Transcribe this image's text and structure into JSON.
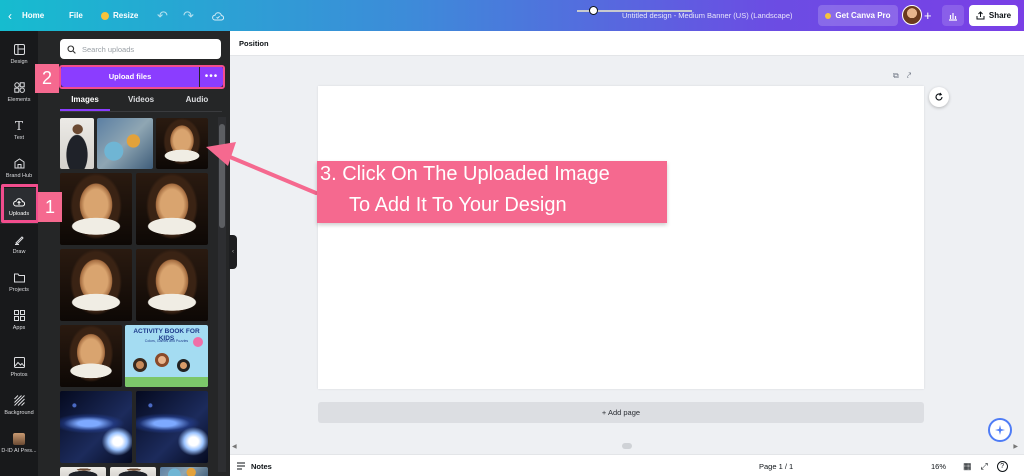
{
  "topbar": {
    "home_label": "Home",
    "file_label": "File",
    "resize_label": "Resize",
    "design_title": "Untitled design - Medium Banner (US) (Landscape)",
    "pro_label": "Get Canva Pro",
    "share_label": "Share"
  },
  "rail": {
    "items": [
      {
        "label": "Design",
        "icon": "layout-icon"
      },
      {
        "label": "Elements",
        "icon": "shapes-icon"
      },
      {
        "label": "Text",
        "icon": "text-icon"
      },
      {
        "label": "Brand Hub",
        "icon": "brand-icon"
      },
      {
        "label": "Uploads",
        "icon": "cloud-upload-icon"
      },
      {
        "label": "Draw",
        "icon": "pen-icon"
      },
      {
        "label": "Projects",
        "icon": "folder-icon"
      },
      {
        "label": "Apps",
        "icon": "apps-icon"
      },
      {
        "label": "Photos",
        "icon": "image-icon"
      },
      {
        "label": "Background",
        "icon": "pattern-icon"
      },
      {
        "label": "D-ID AI Pres...",
        "icon": "app-thumbnail"
      }
    ]
  },
  "panel": {
    "search_placeholder": "Search uploads",
    "upload_label": "Upload files",
    "more_label": "•••",
    "tabs": [
      "Images",
      "Videos",
      "Audio"
    ],
    "book_title": "ACTIVITY BOOK FOR KIDS",
    "book_subtitle": "Colors, Games and Puzzles"
  },
  "editor": {
    "position_label": "Position",
    "add_page_label": "+ Add page",
    "notes_label": "Notes",
    "page_indicator": "Page 1 / 1",
    "zoom_label": "16%",
    "zoom_level": 0.16
  },
  "annotations": {
    "step1": "1",
    "step2": "2",
    "step3_line1": "3. Click On The Uploaded Image",
    "step3_line2": "To Add It To Your Design"
  },
  "colors": {
    "brand_purple": "#8b3dff",
    "annotation_pink": "#f5698f",
    "highlight_pink": "#f24d8d"
  }
}
